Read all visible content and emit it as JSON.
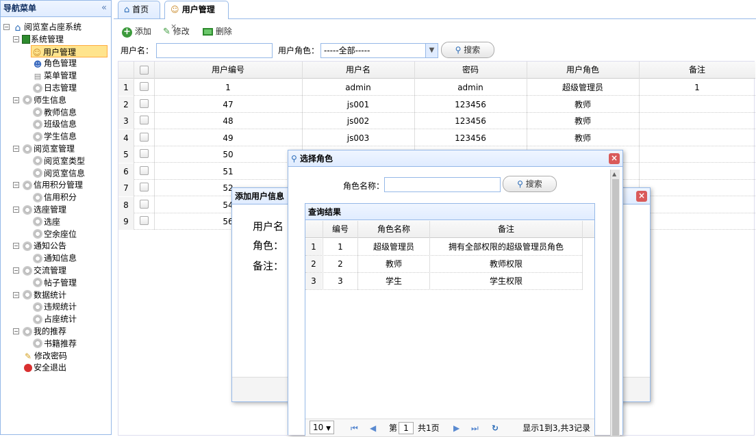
{
  "sidebar": {
    "title": "导航菜单",
    "collapse_icon": "«",
    "tree": [
      {
        "label": "阅览室占座系统",
        "icon": "home-icon",
        "level": 0,
        "expanded": true
      },
      {
        "label": "系统管理",
        "icon": "book-icon",
        "level": 1,
        "expanded": true
      },
      {
        "label": "用户管理",
        "icon": "user-icon",
        "level": 2,
        "selected": true
      },
      {
        "label": "角色管理",
        "icon": "users-icon",
        "level": 2
      },
      {
        "label": "菜单管理",
        "icon": "menu-icon",
        "level": 2
      },
      {
        "label": "日志管理",
        "icon": "gear-icon",
        "level": 2
      },
      {
        "label": "师生信息",
        "icon": "gear-icon",
        "level": 1,
        "expanded": true
      },
      {
        "label": "教师信息",
        "icon": "gear-icon",
        "level": 2
      },
      {
        "label": "班级信息",
        "icon": "gear-icon",
        "level": 2
      },
      {
        "label": "学生信息",
        "icon": "gear-icon",
        "level": 2
      },
      {
        "label": "阅览室管理",
        "icon": "gear-icon",
        "level": 1,
        "expanded": true
      },
      {
        "label": "阅览室类型",
        "icon": "gear-icon",
        "level": 2
      },
      {
        "label": "阅览室信息",
        "icon": "gear-icon",
        "level": 2
      },
      {
        "label": "信用积分管理",
        "icon": "gear-icon",
        "level": 1,
        "expanded": true
      },
      {
        "label": "信用积分",
        "icon": "gear-icon",
        "level": 2
      },
      {
        "label": "选座管理",
        "icon": "gear-icon",
        "level": 1,
        "expanded": true
      },
      {
        "label": "选座",
        "icon": "gear-icon",
        "level": 2
      },
      {
        "label": "空余座位",
        "icon": "gear-icon",
        "level": 2
      },
      {
        "label": "通知公告",
        "icon": "gear-icon",
        "level": 1,
        "expanded": true
      },
      {
        "label": "通知信息",
        "icon": "gear-icon",
        "level": 2
      },
      {
        "label": "交流管理",
        "icon": "gear-icon",
        "level": 1,
        "expanded": true
      },
      {
        "label": "帖子管理",
        "icon": "gear-icon",
        "level": 2
      },
      {
        "label": "数据统计",
        "icon": "gear-icon",
        "level": 1,
        "expanded": true
      },
      {
        "label": "违规统计",
        "icon": "gear-icon",
        "level": 2
      },
      {
        "label": "占座统计",
        "icon": "gear-icon",
        "level": 2
      },
      {
        "label": "我的推荐",
        "icon": "gear-icon",
        "level": 1,
        "expanded": true
      },
      {
        "label": "书籍推荐",
        "icon": "gear-icon",
        "level": 2
      },
      {
        "label": "修改密码",
        "icon": "edit-icon",
        "level": 1
      },
      {
        "label": "安全退出",
        "icon": "exit-icon",
        "level": 1
      }
    ]
  },
  "tabs": [
    {
      "label": "首页",
      "icon": "home-icon"
    },
    {
      "label": "用户管理",
      "icon": "user-icon",
      "close": "×"
    }
  ],
  "toolbar": {
    "add": "添加",
    "edit": "修改",
    "delete": "删除"
  },
  "search": {
    "username_label": "用户名：",
    "username_value": "",
    "role_label": "用户角色：",
    "role_value": "-----全部-----",
    "search_button": "搜索"
  },
  "grid": {
    "columns": [
      "用户编号",
      "用户名",
      "密码",
      "用户角色",
      "备注"
    ],
    "rows": [
      {
        "n": "1",
        "id": "1",
        "name": "admin",
        "pwd": "admin",
        "role": "超级管理员",
        "note": "1"
      },
      {
        "n": "2",
        "id": "47",
        "name": "js001",
        "pwd": "123456",
        "role": "教师",
        "note": ""
      },
      {
        "n": "3",
        "id": "48",
        "name": "js002",
        "pwd": "123456",
        "role": "教师",
        "note": ""
      },
      {
        "n": "4",
        "id": "49",
        "name": "js003",
        "pwd": "123456",
        "role": "教师",
        "note": ""
      },
      {
        "n": "5",
        "id": "50",
        "name": "",
        "pwd": "",
        "role": "",
        "note": ""
      },
      {
        "n": "6",
        "id": "51",
        "name": "",
        "pwd": "",
        "role": "",
        "note": ""
      },
      {
        "n": "7",
        "id": "52",
        "name": "",
        "pwd": "",
        "role": "",
        "note": ""
      },
      {
        "n": "8",
        "id": "54",
        "name": "",
        "pwd": "",
        "role": "",
        "note": ""
      },
      {
        "n": "9",
        "id": "56",
        "name": "",
        "pwd": "",
        "role": "",
        "note": ""
      }
    ]
  },
  "add_dialog": {
    "title": "添加用户信息",
    "username_label": "用户名",
    "role_label": "角色：",
    "note_label": "备注：",
    "close": "×"
  },
  "role_dialog": {
    "title": "选择角色",
    "close": "×",
    "name_label": "角色名称：",
    "name_value": "",
    "search_button": "搜索",
    "panel_title": "查询结果",
    "columns": [
      "编号",
      "角色名称",
      "备注"
    ],
    "rows": [
      {
        "n": "1",
        "id": "1",
        "name": "超级管理员",
        "note": "拥有全部权限的超级管理员角色"
      },
      {
        "n": "2",
        "id": "2",
        "name": "教师",
        "note": "教师权限"
      },
      {
        "n": "3",
        "id": "3",
        "name": "学生",
        "note": "学生权限"
      }
    ],
    "pager": {
      "page_size": "10",
      "page_label_before": "第",
      "page": "1",
      "page_label_after": "共1页",
      "summary": "显示1到3,共3记录"
    }
  }
}
